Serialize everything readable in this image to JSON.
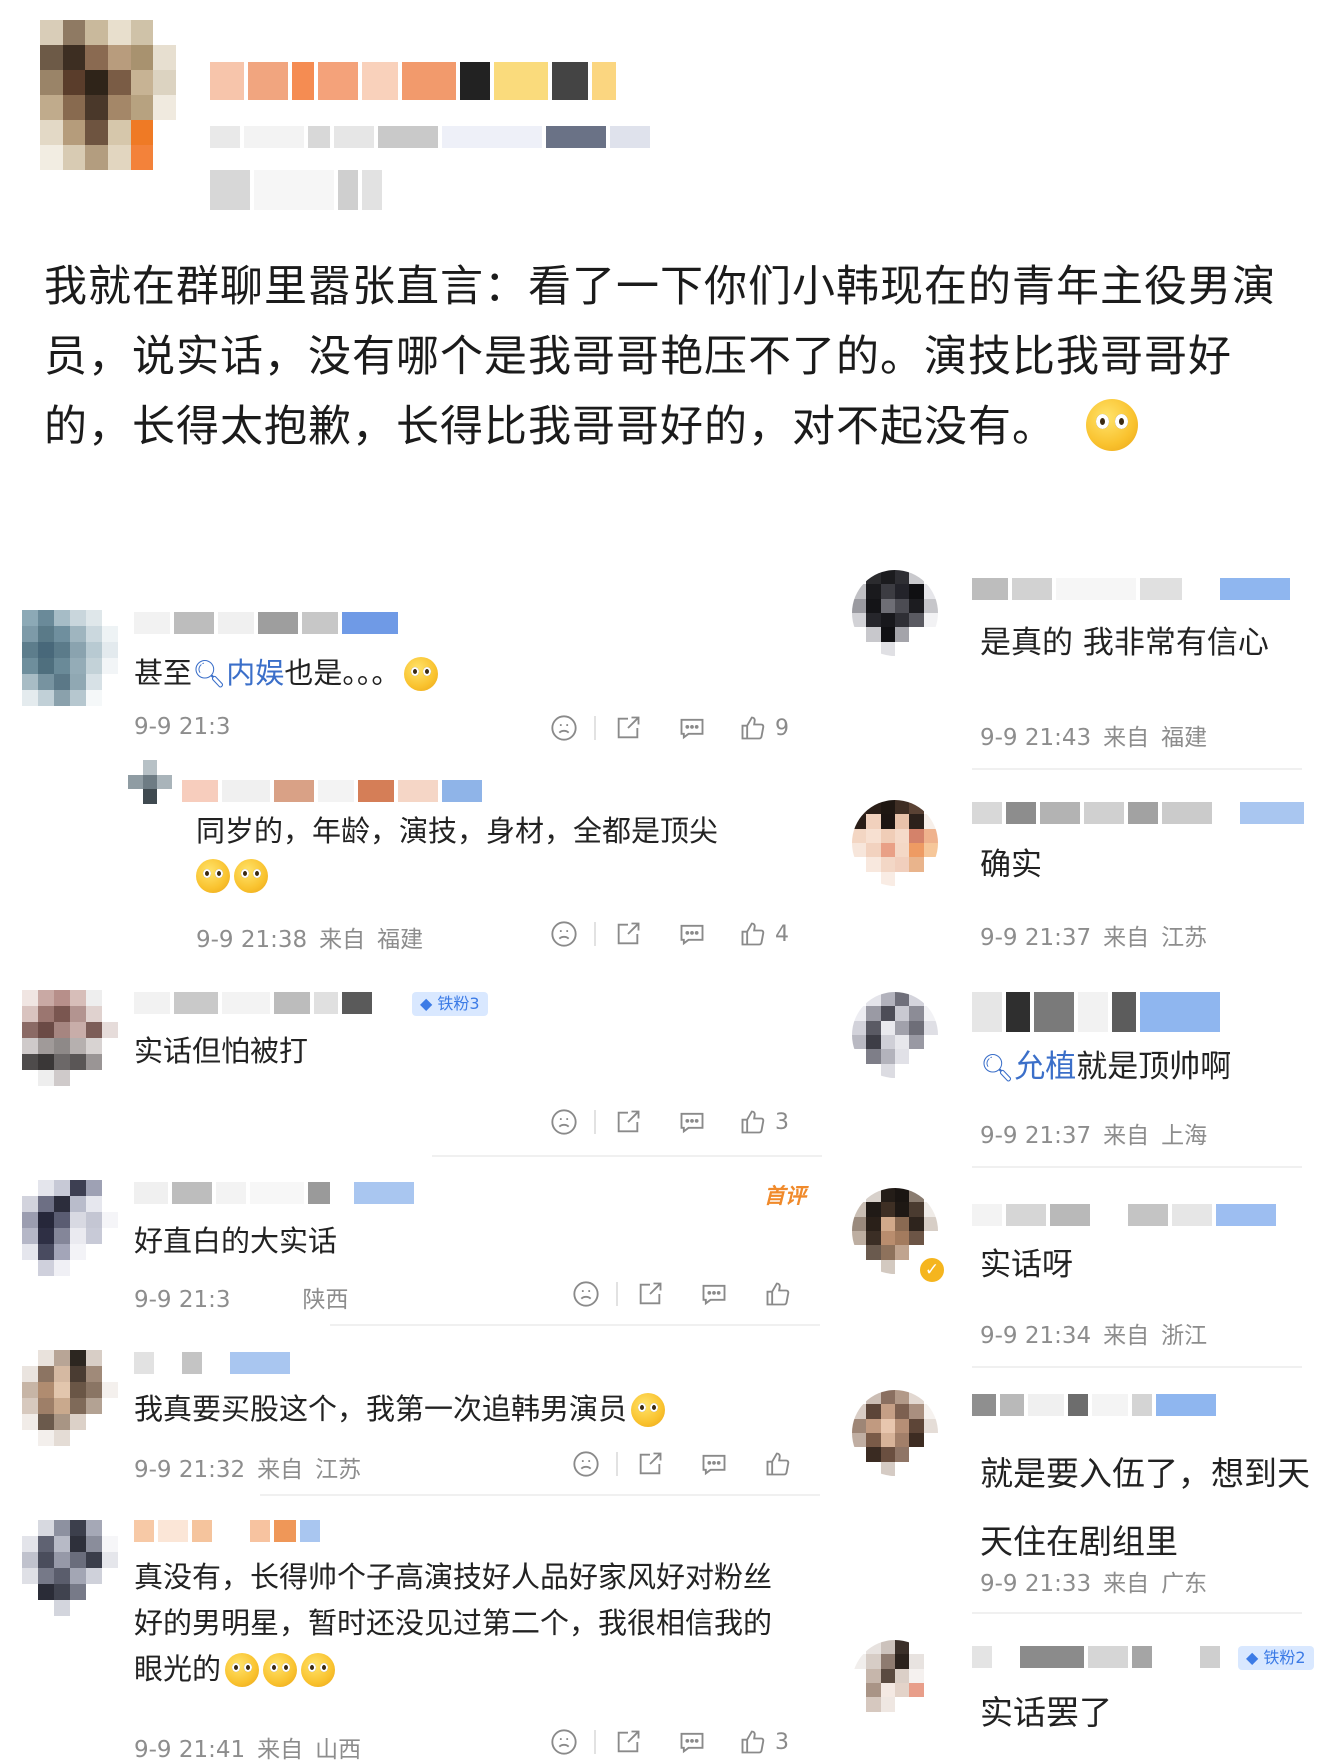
{
  "post": {
    "text": "我就在群聊里嚣张直言：看了一下你们小韩现在的青年主役男演员，说实话，没有哪个是我哥哥艳压不了的。演技比我哥哥好的，长得太抱歉，长得比我哥哥好的，对不起没有。",
    "emoji": "praying-emoji"
  },
  "colors": {
    "link": "#3b6fc9",
    "meta": "#8d8d8d",
    "first_tag": "#f08a2b",
    "badge_bg": "#d9e8ff"
  },
  "left_comments": [
    {
      "pre": "甚至",
      "link": "内娱",
      "post": "也是。。。",
      "meta_time": "9-9 21:3",
      "like_count": "9"
    },
    {
      "text": "同岁的，年龄，演技，身材，全都是顶尖",
      "meta_time": "9-9 21:38",
      "meta_from": "来自",
      "meta_region": "福建",
      "like_count": "4"
    },
    {
      "text": "实话但怕被打",
      "badge": "铁粉3",
      "like_count": "3"
    },
    {
      "text": "好直白的大实话",
      "first_tag": "首评",
      "meta_time": "9-9 21:3",
      "meta_region": "陕西"
    },
    {
      "text": "我真要买股这个，我第一次追韩男演员",
      "meta_time": "9-9 21:32",
      "meta_from": "来自",
      "meta_region": "江苏"
    },
    {
      "text": "真没有，长得帅个子高演技好人品好家风好对粉丝好的男明星，暂时还没见过第二个，我很相信我的眼光的",
      "meta_time": "9-9 21:41",
      "meta_from": "来自",
      "meta_region": "山西",
      "like_count": "3"
    }
  ],
  "right_comments": [
    {
      "text": "是真的 我非常有信心",
      "meta_time": "9-9 21:43",
      "meta_from": "来自",
      "meta_region": "福建"
    },
    {
      "text": "确实",
      "meta_time": "9-9 21:37",
      "meta_from": "来自",
      "meta_region": "江苏"
    },
    {
      "link": "允植",
      "post": "就是顶帅啊",
      "meta_time": "9-9 21:37",
      "meta_from": "来自",
      "meta_region": "上海"
    },
    {
      "text": "实话呀",
      "meta_time": "9-9 21:34",
      "meta_from": "来自",
      "meta_region": "浙江"
    },
    {
      "text": "就是要入伍了，想到天天住在剧组里",
      "meta_time": "9-9 21:33",
      "meta_from": "来自",
      "meta_region": "广东"
    },
    {
      "text": "实话罢了",
      "badge": "铁粉2"
    }
  ]
}
